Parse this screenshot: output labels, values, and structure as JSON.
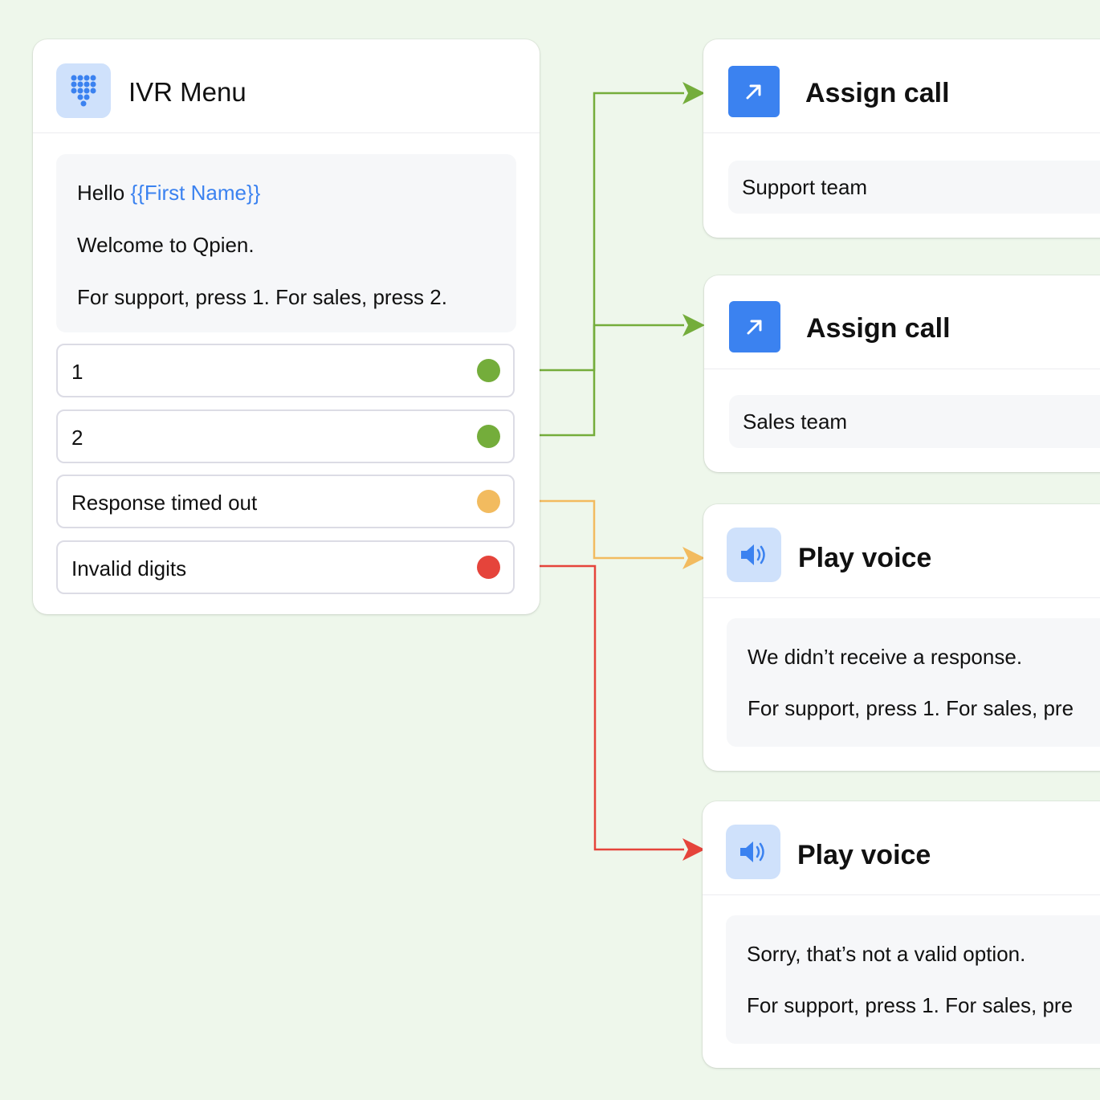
{
  "colors": {
    "background": "#eef7eb",
    "accent": "#3b82f0",
    "green": "#74ad3b",
    "orange": "#f2bb5f",
    "red": "#e5443b"
  },
  "ivr_menu": {
    "title": "IVR Menu",
    "icon": "keypad-icon",
    "message": {
      "hello": "Hello",
      "variable": "{{First Name}}",
      "line2": "Welcome to Qpien.",
      "line3": "For support, press 1. For sales, press 2."
    },
    "options": [
      {
        "label": "1",
        "status": "green"
      },
      {
        "label": "2",
        "status": "green"
      },
      {
        "label": "Response timed out",
        "status": "orange"
      },
      {
        "label": "Invalid digits",
        "status": "red"
      }
    ]
  },
  "nodes": [
    {
      "title": "Assign call",
      "icon": "arrow-up-right-icon",
      "body": "Support team"
    },
    {
      "title": "Assign call",
      "icon": "arrow-up-right-icon",
      "body": "Sales team"
    },
    {
      "title": "Play voice",
      "icon": "speaker-icon",
      "line1": "We didn’t receive a response.",
      "line2": "For support, press 1. For sales, pre"
    },
    {
      "title": "Play voice",
      "icon": "speaker-icon",
      "line1": "Sorry, that’s not a valid option.",
      "line2": "For support, press 1. For sales, pre"
    }
  ]
}
